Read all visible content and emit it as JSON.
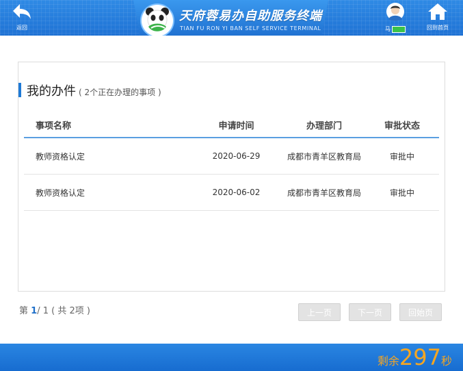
{
  "header": {
    "back_label": "返回",
    "brand_title": "天府蓉易办自助服务终端",
    "brand_subtitle": "TIAN FU RON YI BAN SELF SERVICE TERMINAL",
    "user_name": "马",
    "home_label": "回到首页"
  },
  "panel": {
    "title": "我的办件",
    "subtitle": "( 2个正在办理的事项 )",
    "columns": [
      "事项名称",
      "申请时间",
      "办理部门",
      "审批状态"
    ],
    "rows": [
      {
        "name": "教师资格认定",
        "date": "2020-06-29",
        "dept": "成都市青羊区教育局",
        "status": "审批中"
      },
      {
        "name": "教师资格认定",
        "date": "2020-06-02",
        "dept": "成都市青羊区教育局",
        "status": "审批中"
      }
    ]
  },
  "pager": {
    "prefix": "第",
    "current": "1",
    "rest": "/ 1 ( 共 2项 )",
    "prev_label": "上一页",
    "next_label": "下一页",
    "first_label": "回始页"
  },
  "footer": {
    "countdown_prefix": "剩余",
    "countdown_value": "297",
    "countdown_suffix": "秒"
  },
  "colors": {
    "primary": "#1f72d4",
    "accent": "#f5a623",
    "mask": "#39c24a"
  }
}
